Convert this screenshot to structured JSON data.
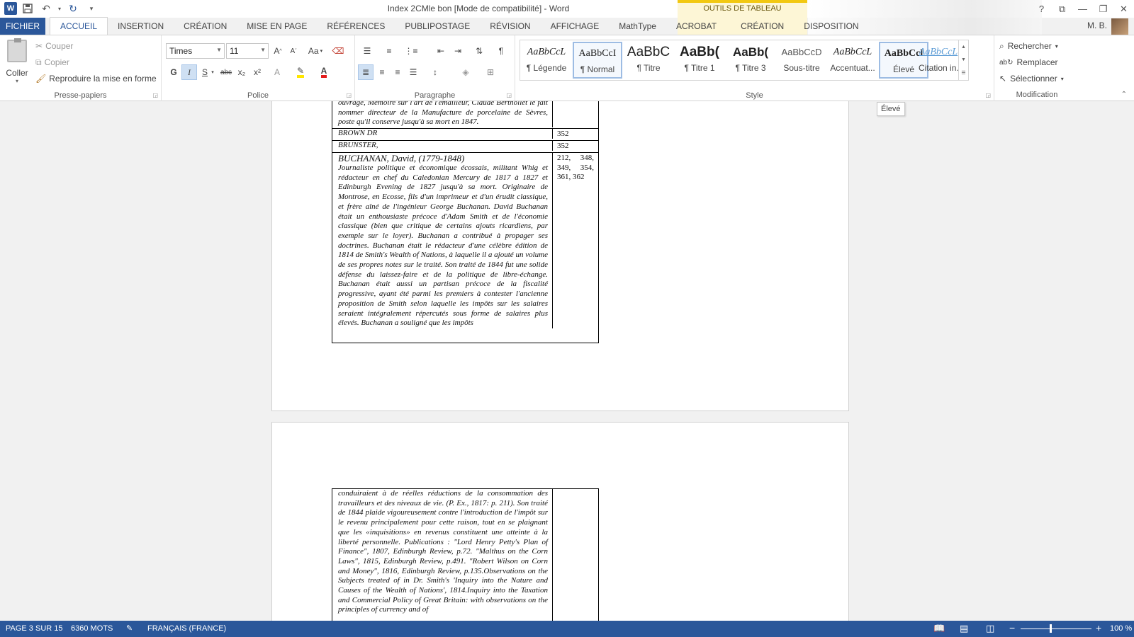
{
  "titlebar": {
    "title": "Index 2CMle bon [Mode de compatibilité] - Word",
    "context_label": "OUTILS DE TABLEAU",
    "help": "?"
  },
  "tabs": [
    "FICHIER",
    "ACCUEIL",
    "INSERTION",
    "CRÉATION",
    "MISE EN PAGE",
    "RÉFÉRENCES",
    "PUBLIPOSTAGE",
    "RÉVISION",
    "AFFICHAGE",
    "MathType",
    "ACROBAT",
    "CRÉATION",
    "DISPOSITION"
  ],
  "active_tab": "ACCUEIL",
  "user": "M. B.",
  "clipboard": {
    "paste": "Coller",
    "cut": "Couper",
    "copy": "Copier",
    "format_painter": "Reproduire la mise en forme",
    "label": "Presse-papiers"
  },
  "font": {
    "name": "Times",
    "size": "11",
    "label": "Police",
    "case_btn": "Aa",
    "bold": "G",
    "italic": "I",
    "underline": "S",
    "strike": "abc",
    "subscript": "x₂",
    "superscript": "x²"
  },
  "paragraph": {
    "label": "Paragraphe"
  },
  "styles": {
    "label": "Style",
    "items": [
      {
        "preview": "AaBbCcL",
        "name": "¶ Légende"
      },
      {
        "preview": "AaBbCcI",
        "name": "¶ Normal"
      },
      {
        "preview": "AaBbC",
        "name": "¶ Titre"
      },
      {
        "preview": "AaBb(",
        "name": "¶ Titre 1"
      },
      {
        "preview": "AaBb(",
        "name": "¶ Titre 3"
      },
      {
        "preview": "AaBbCcD",
        "name": "Sous-titre"
      },
      {
        "preview": "AaBbCcL",
        "name": "Accentuat..."
      },
      {
        "preview": "AaBbCcl",
        "name": "Élevé"
      },
      {
        "preview": "AaBbCcL",
        "name": "Citation in..."
      }
    ]
  },
  "editing": {
    "label": "Modification",
    "find": "Rechercher",
    "replace": "Remplacer",
    "select": "Sélectionner"
  },
  "tooltip": "Élevé",
  "document": {
    "page1": {
      "top_text": "ouvrage, Mémoire sur l'art de l'émailleur, Claude Berthollet le fait nommer directeur de la Manufacture de porcelaine de Sèvres, poste qu'il conserve jusqu'à sa mort en 1847.",
      "rows": [
        {
          "name": "BROWN DR",
          "pages": "352"
        },
        {
          "name": "BRUNSTER,",
          "pages": "352"
        }
      ],
      "buchanan_name": "BUCHANAN, David,  (1779-1848)",
      "buchanan_pages": "212, 348, 349, 354, 361, 362",
      "buchanan_text": "Journaliste politique et économique écossais, militant Whig et rédacteur en chef du Caledonian Mercury de 1817 à 1827 et Edinburgh Evening de 1827 jusqu'à sa mort. Originaire de Montrose, en Ecosse, fils d'un imprimeur et d'un érudit classique, et frère aîné de l'ingénieur George Buchanan. David Buchanan était un enthousiaste précoce d'Adam Smith et de l'économie classique (bien que critique de certains ajouts ricardiens, par exemple sur le loyer). Buchanan a contribué à propager ses doctrines. Buchanan était le rédacteur d'une célèbre édition de 1814 de Smith's Wealth of Nations, à laquelle il a ajouté un volume de ses propres notes sur le traité. Son traité de 1844 fut une solide défense du laissez-faire et de la politique de libre-échange. Buchanan était aussi un partisan précoce de la fiscalité progressive, ayant été parmi les premiers à contester l'ancienne proposition de Smith selon laquelle les impôts sur les salaires seraient intégralement répercutés sous forme de salaires plus élevés. Buchanan a souligné que les impôts"
    },
    "page2": {
      "text": "conduiraient à de réelles réductions de la consommation des travailleurs et des niveaux de vie. (P. Ex., 1817: p. 211). Son traité de 1844 plaide vigoureusement contre l'introduction de l'impôt sur le revenu principalement pour cette raison, tout en se plaignant que les «inquisitions» en revenus constituent une atteinte à la liberté personnelle. Publications : \"Lord Henry Petty's Plan of Finance\", 1807, Edinburgh Review, p.72. \"Malthus on the Corn Laws\", 1815, Edinburgh Review, p.491. \"Robert Wilson on Corn and Money\", 1816, Edinburgh Review, p.135.Observations on the Subjects treated of in Dr. Smith's 'Inquiry into the Nature and Causes of the Wealth of Nations', 1814.Inquiry into the Taxation and Commercial Policy of Great Britain: with observations on the principles of currency and of"
    }
  },
  "status": {
    "page": "PAGE 3 SUR 15",
    "words": "6360 MOTS",
    "language": "FRANÇAIS (FRANCE)",
    "zoom": "100 %",
    "zoom_level_percent": 100
  }
}
